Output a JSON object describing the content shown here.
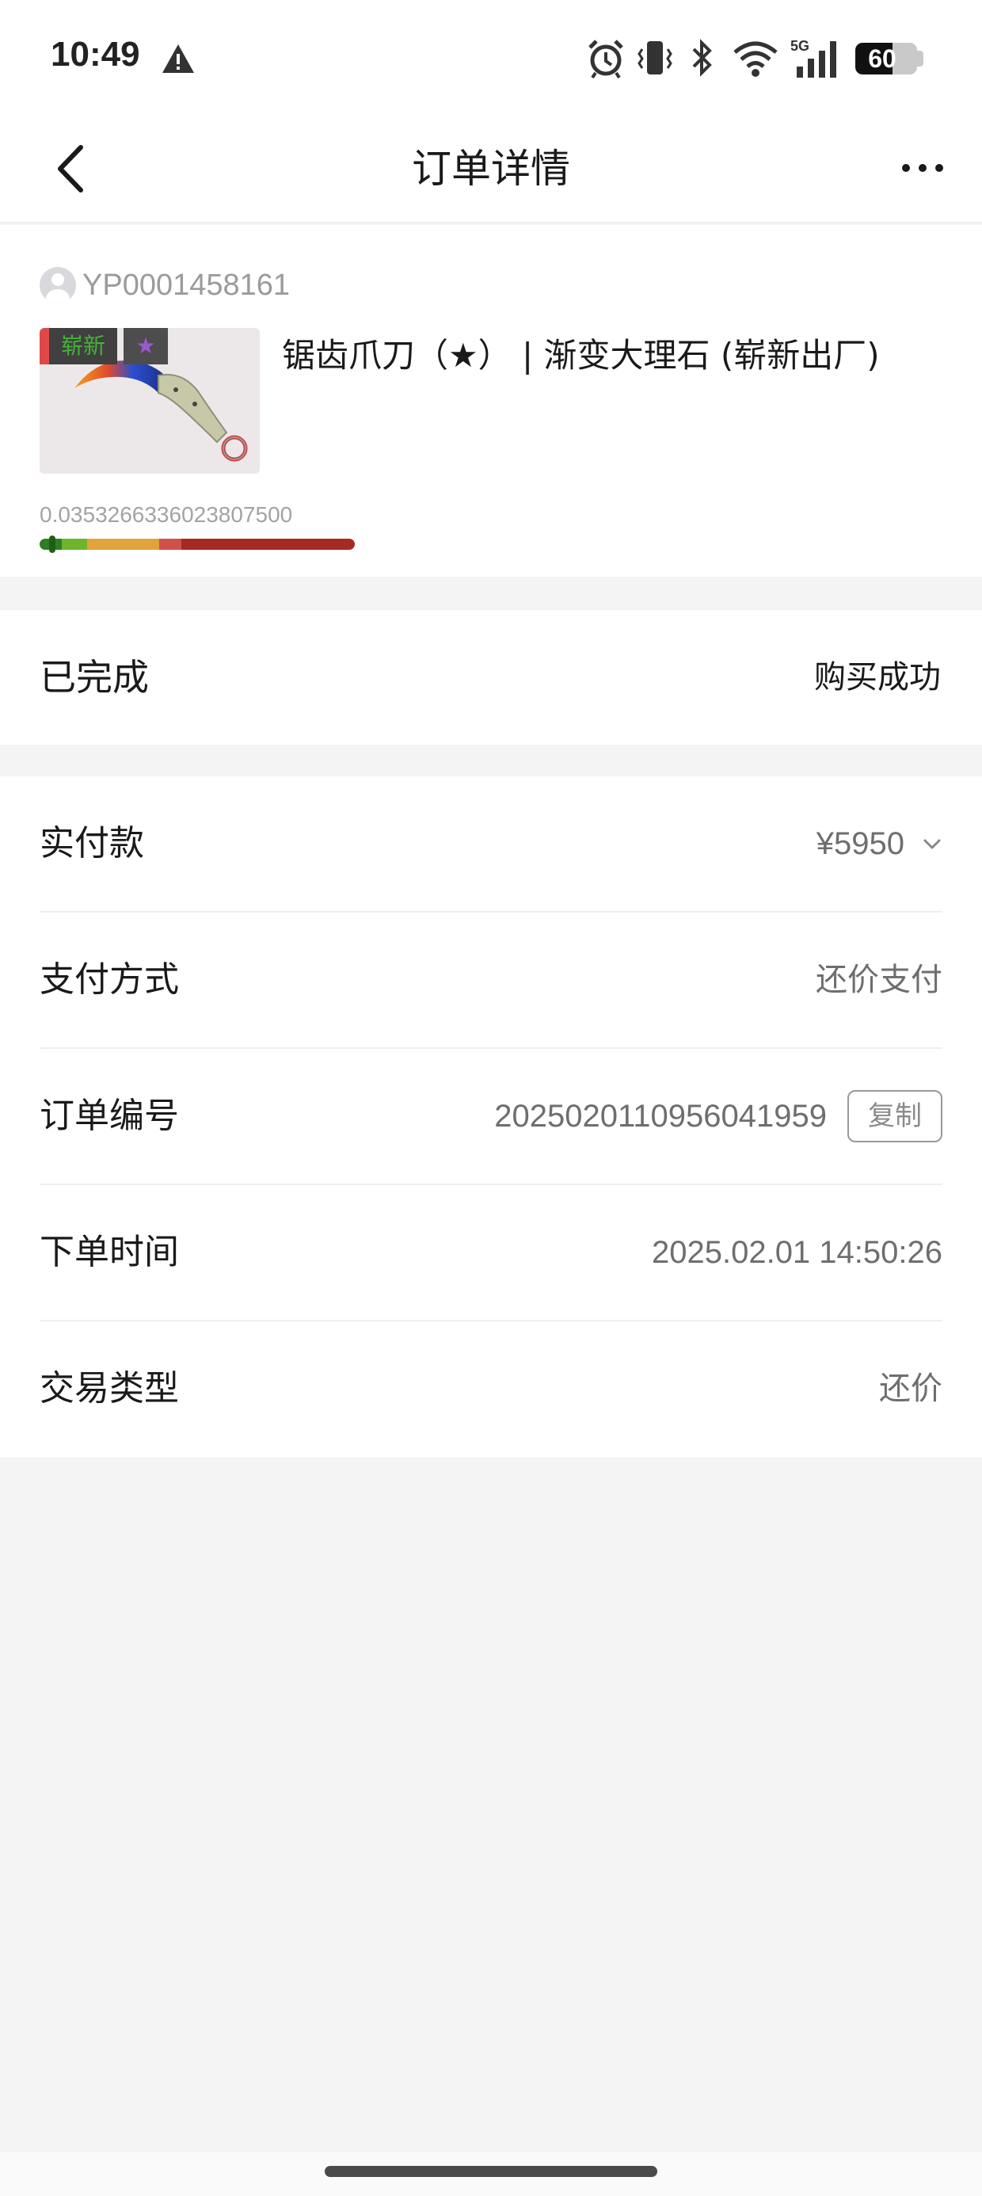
{
  "status_bar": {
    "time": "10:49",
    "battery_level": 0.6,
    "battery_text": "60",
    "icons": [
      "warning-icon",
      "alarm-icon",
      "vibrate-icon",
      "bluetooth-icon",
      "wifi-icon",
      "signal-5g-icon",
      "battery-icon"
    ]
  },
  "nav": {
    "title": "订单详情",
    "back_icon": "chevron-left-icon",
    "more_icon": "more-horizontal-icon"
  },
  "product": {
    "seller_id": "YP0001458161",
    "quality_tag": "崭新",
    "star_tag": "★",
    "name": "锯齿爪刀（★） | 渐变大理石 (崭新出厂)",
    "float_value": "0.0353266336023807500",
    "float_fraction": 0.0353,
    "wear_colors": [
      "#2f7d24",
      "#6fb52c",
      "#e2a43a",
      "#d0504a",
      "#a52a24"
    ]
  },
  "order_status": {
    "label": "已完成",
    "result": "购买成功"
  },
  "details": {
    "paid_label": "实付款",
    "paid_value": "¥5950",
    "payment_method_label": "支付方式",
    "payment_method_value": "还价支付",
    "order_no_label": "订单编号",
    "order_no_value": "2025020110956041959",
    "copy_label": "复制",
    "order_time_label": "下单时间",
    "order_time_value": "2025.02.01 14:50:26",
    "trade_type_label": "交易类型",
    "trade_type_value": "还价"
  }
}
